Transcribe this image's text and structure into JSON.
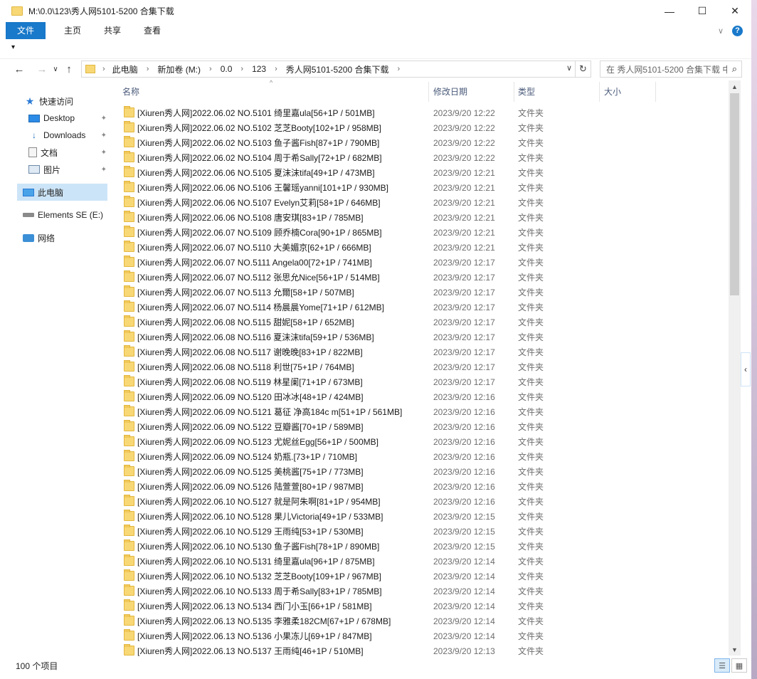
{
  "window": {
    "title": "M:\\0.0\\123\\秀人网5101-5200 合集下载",
    "minimize": "—",
    "maximize": "☐",
    "close": "✕"
  },
  "ribbon": {
    "tabs": [
      "文件",
      "主页",
      "共享",
      "查看"
    ],
    "expand": "∨",
    "help": "?"
  },
  "qat": {
    "dropdown": "▾"
  },
  "nav": {
    "back": "←",
    "forward": "→",
    "recent": "∨",
    "up": "↑"
  },
  "address": {
    "crumbs": [
      "此电脑",
      "新加卷 (M:)",
      "0.0",
      "123",
      "秀人网5101-5200 合集下载"
    ],
    "dropdown": "∨",
    "refresh": "↻"
  },
  "search": {
    "placeholder": "在 秀人网5101-5200 合集下载 中搜索",
    "icon": "⌕"
  },
  "sidebar": {
    "quick_access": "快速访问",
    "desktop": "Desktop",
    "downloads": "Downloads",
    "documents": "文档",
    "pictures": "图片",
    "this_pc": "此电脑",
    "drive": "Elements SE (E:)",
    "network": "网络",
    "pin": "📌"
  },
  "columns": {
    "name": "名称",
    "date": "修改日期",
    "type": "类型",
    "size": "大小",
    "sort_indicator": "^"
  },
  "files": [
    {
      "name": "[Xiuren秀人网]2022.06.02 NO.5101 绮里嘉ula[56+1P / 501MB]",
      "date": "2023/9/20 12:22",
      "type": "文件夹"
    },
    {
      "name": "[Xiuren秀人网]2022.06.02 NO.5102 芝芝Booty[102+1P / 958MB]",
      "date": "2023/9/20 12:22",
      "type": "文件夹"
    },
    {
      "name": "[Xiuren秀人网]2022.06.02 NO.5103 鱼子酱Fish[87+1P / 790MB]",
      "date": "2023/9/20 12:22",
      "type": "文件夹"
    },
    {
      "name": "[Xiuren秀人网]2022.06.02 NO.5104 周于希Sally[72+1P / 682MB]",
      "date": "2023/9/20 12:22",
      "type": "文件夹"
    },
    {
      "name": "[Xiuren秀人网]2022.06.06 NO.5105 夏沫沫tifa[49+1P / 473MB]",
      "date": "2023/9/20 12:21",
      "type": "文件夹"
    },
    {
      "name": "[Xiuren秀人网]2022.06.06 NO.5106 王馨瑶yanni[101+1P / 930MB]",
      "date": "2023/9/20 12:21",
      "type": "文件夹"
    },
    {
      "name": "[Xiuren秀人网]2022.06.06 NO.5107 Evelyn艾莉[58+1P / 646MB]",
      "date": "2023/9/20 12:21",
      "type": "文件夹"
    },
    {
      "name": "[Xiuren秀人网]2022.06.06 NO.5108 唐安琪[83+1P / 785MB]",
      "date": "2023/9/20 12:21",
      "type": "文件夹"
    },
    {
      "name": "[Xiuren秀人网]2022.06.07 NO.5109 顾乔楠Cora[90+1P / 865MB]",
      "date": "2023/9/20 12:21",
      "type": "文件夹"
    },
    {
      "name": "[Xiuren秀人网]2022.06.07 NO.5110 大美媚京[62+1P / 666MB]",
      "date": "2023/9/20 12:21",
      "type": "文件夹"
    },
    {
      "name": "[Xiuren秀人网]2022.06.07 NO.5111 Angela00[72+1P / 741MB]",
      "date": "2023/9/20 12:17",
      "type": "文件夹"
    },
    {
      "name": "[Xiuren秀人网]2022.06.07 NO.5112 张思允Nice[56+1P / 514MB]",
      "date": "2023/9/20 12:17",
      "type": "文件夹"
    },
    {
      "name": "[Xiuren秀人网]2022.06.07 NO.5113 允爾[58+1P / 507MB]",
      "date": "2023/9/20 12:17",
      "type": "文件夹"
    },
    {
      "name": "[Xiuren秀人网]2022.06.07 NO.5114 杨晨晨Yome[71+1P / 612MB]",
      "date": "2023/9/20 12:17",
      "type": "文件夹"
    },
    {
      "name": "[Xiuren秀人网]2022.06.08 NO.5115 甜妮[58+1P / 652MB]",
      "date": "2023/9/20 12:17",
      "type": "文件夹"
    },
    {
      "name": "[Xiuren秀人网]2022.06.08 NO.5116 夏沫沫tifa[59+1P / 536MB]",
      "date": "2023/9/20 12:17",
      "type": "文件夹"
    },
    {
      "name": "[Xiuren秀人网]2022.06.08 NO.5117 谢晚晚[83+1P / 822MB]",
      "date": "2023/9/20 12:17",
      "type": "文件夹"
    },
    {
      "name": "[Xiuren秀人网]2022.06.08 NO.5118 利世[75+1P / 764MB]",
      "date": "2023/9/20 12:17",
      "type": "文件夹"
    },
    {
      "name": "[Xiuren秀人网]2022.06.08 NO.5119 林星阑[71+1P / 673MB]",
      "date": "2023/9/20 12:17",
      "type": "文件夹"
    },
    {
      "name": "[Xiuren秀人网]2022.06.09 NO.5120 田冰冰[48+1P / 424MB]",
      "date": "2023/9/20 12:16",
      "type": "文件夹"
    },
    {
      "name": "[Xiuren秀人网]2022.06.09 NO.5121 葛征 净高184c m[51+1P / 561MB]",
      "date": "2023/9/20 12:16",
      "type": "文件夹"
    },
    {
      "name": "[Xiuren秀人网]2022.06.09 NO.5122 豆瓣酱[70+1P / 589MB]",
      "date": "2023/9/20 12:16",
      "type": "文件夹"
    },
    {
      "name": "[Xiuren秀人网]2022.06.09 NO.5123 尤妮丝Egg[56+1P / 500MB]",
      "date": "2023/9/20 12:16",
      "type": "文件夹"
    },
    {
      "name": "[Xiuren秀人网]2022.06.09 NO.5124 奶瓶.[73+1P / 710MB]",
      "date": "2023/9/20 12:16",
      "type": "文件夹"
    },
    {
      "name": "[Xiuren秀人网]2022.06.09 NO.5125 美桃酱[75+1P / 773MB]",
      "date": "2023/9/20 12:16",
      "type": "文件夹"
    },
    {
      "name": "[Xiuren秀人网]2022.06.09 NO.5126 陆萱萱[80+1P / 987MB]",
      "date": "2023/9/20 12:16",
      "type": "文件夹"
    },
    {
      "name": "[Xiuren秀人网]2022.06.10 NO.5127 就是阿朱啊[81+1P / 954MB]",
      "date": "2023/9/20 12:16",
      "type": "文件夹"
    },
    {
      "name": "[Xiuren秀人网]2022.06.10 NO.5128 果儿Victoria[49+1P / 533MB]",
      "date": "2023/9/20 12:15",
      "type": "文件夹"
    },
    {
      "name": "[Xiuren秀人网]2022.06.10 NO.5129 王雨纯[53+1P / 530MB]",
      "date": "2023/9/20 12:15",
      "type": "文件夹"
    },
    {
      "name": "[Xiuren秀人网]2022.06.10 NO.5130 鱼子酱Fish[78+1P / 890MB]",
      "date": "2023/9/20 12:15",
      "type": "文件夹"
    },
    {
      "name": "[Xiuren秀人网]2022.06.10 NO.5131 绮里嘉ula[96+1P / 875MB]",
      "date": "2023/9/20 12:14",
      "type": "文件夹"
    },
    {
      "name": "[Xiuren秀人网]2022.06.10 NO.5132 芝芝Booty[109+1P / 967MB]",
      "date": "2023/9/20 12:14",
      "type": "文件夹"
    },
    {
      "name": "[Xiuren秀人网]2022.06.10 NO.5133 周于希Sally[83+1P / 785MB]",
      "date": "2023/9/20 12:14",
      "type": "文件夹"
    },
    {
      "name": "[Xiuren秀人网]2022.06.13 NO.5134 西门小玉[66+1P / 581MB]",
      "date": "2023/9/20 12:14",
      "type": "文件夹"
    },
    {
      "name": "[Xiuren秀人网]2022.06.13 NO.5135 李雅柔182CM[67+1P / 678MB]",
      "date": "2023/9/20 12:14",
      "type": "文件夹"
    },
    {
      "name": "[Xiuren秀人网]2022.06.13 NO.5136 小果冻儿[69+1P / 847MB]",
      "date": "2023/9/20 12:14",
      "type": "文件夹"
    },
    {
      "name": "[Xiuren秀人网]2022.06.13 NO.5137 王雨纯[46+1P / 510MB]",
      "date": "2023/9/20 12:13",
      "type": "文件夹"
    }
  ],
  "status": {
    "count": "100 个项目",
    "details_view": "☰",
    "tiles_view": "▦"
  },
  "scroll": {
    "up": "▲",
    "down": "▼",
    "collapse": "‹"
  }
}
